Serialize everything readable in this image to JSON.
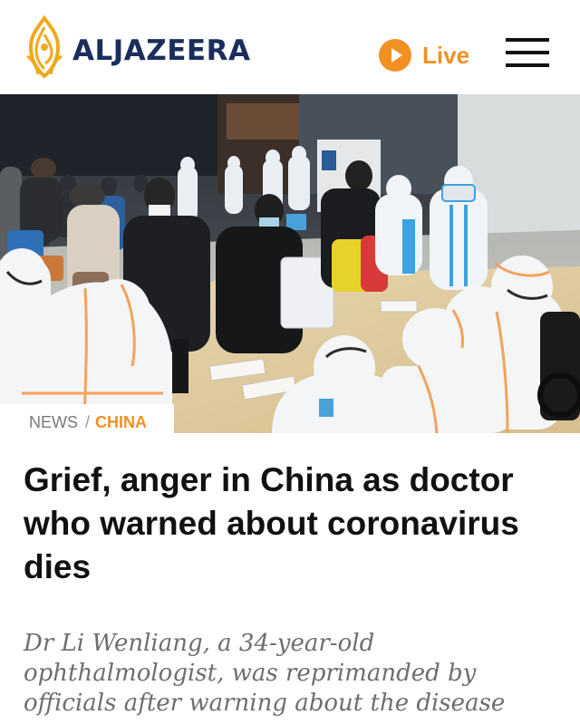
{
  "header": {
    "logo_text": "ALJAZEERA",
    "live_label": "Live",
    "menu_icon": "hamburger-menu-icon",
    "live_icon": "play-circle-icon"
  },
  "colors": {
    "brand_navy": "#1b2d5c",
    "accent_orange": "#f39022",
    "crumb_grey": "#7a7a7a"
  },
  "article": {
    "breadcrumb": {
      "section": "NEWS",
      "separator": "/",
      "topic": "CHINA"
    },
    "headline": "Grief, anger in China as doctor who warned about coronavirus dies",
    "standfirst": "Dr Li Wenliang, a 34-year-old ophthalmologist, was reprimanded by officials after warning about the disease"
  }
}
